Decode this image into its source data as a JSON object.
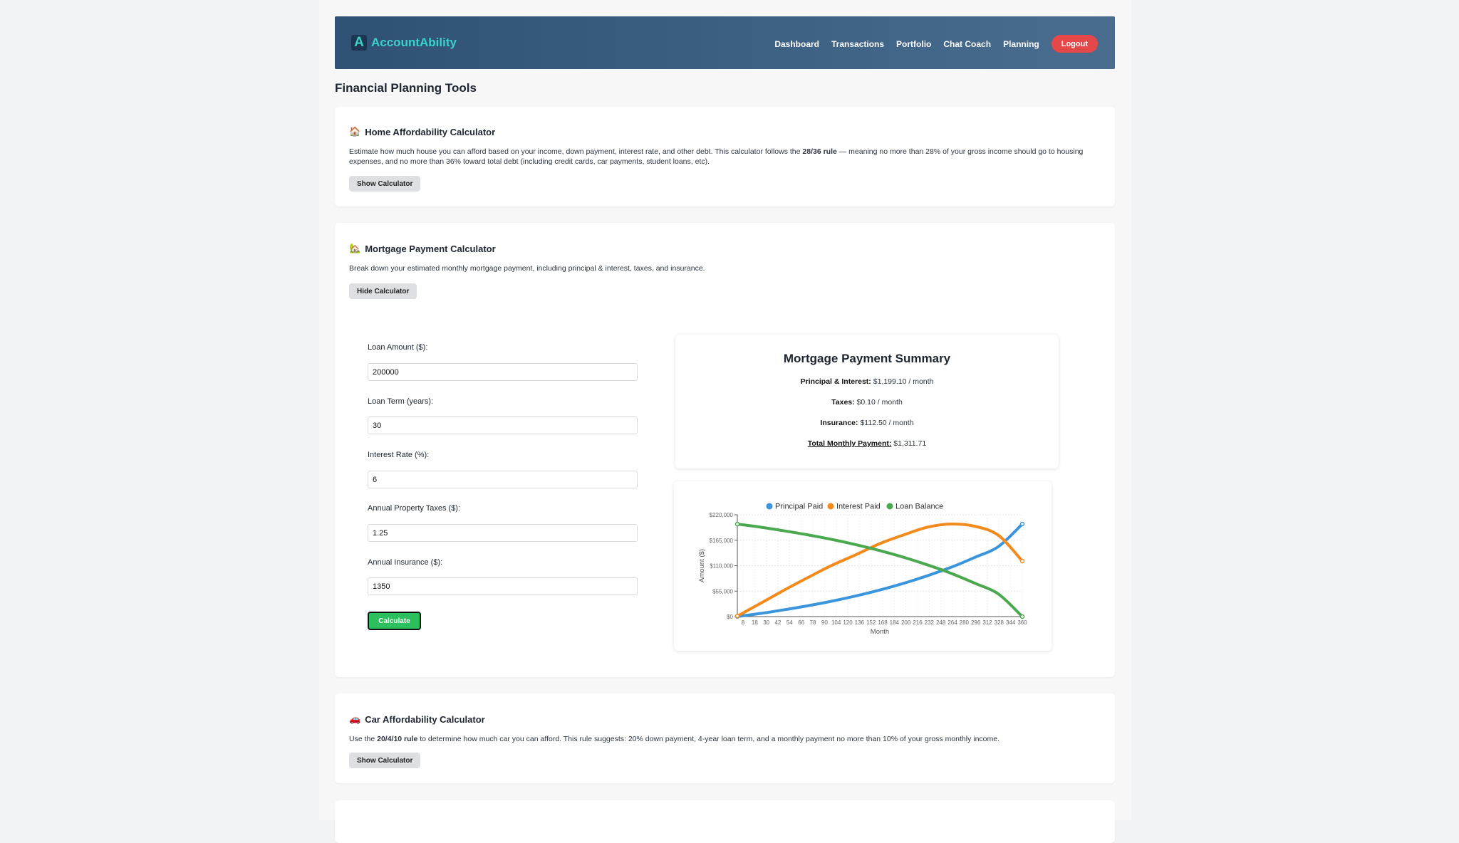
{
  "app": {
    "logo_letter": "A",
    "name": "AccountAbility"
  },
  "nav": {
    "links": [
      "Dashboard",
      "Transactions",
      "Portfolio",
      "Chat Coach",
      "Planning"
    ],
    "logout": "Logout"
  },
  "page_title": "Financial Planning Tools",
  "home": {
    "icon": "🏠",
    "title": "Home Affordability Calculator",
    "desc_pre": "Estimate how much house you can afford based on your income, down payment, interest rate, and other debt. This calculator follows the ",
    "desc_bold": "28/36 rule",
    "desc_post": " — meaning no more than 28% of your gross income should go to housing expenses, and no more than 36% toward total debt (including credit cards, car payments, student loans, etc).",
    "button": "Show Calculator"
  },
  "mortgage": {
    "icon": "🏡",
    "title": "Mortgage Payment Calculator",
    "desc": "Break down your estimated monthly mortgage payment, including principal & interest, taxes, and insurance.",
    "button": "Hide Calculator",
    "fields": {
      "loan_amount": {
        "label": "Loan Amount ($):",
        "value": "200000"
      },
      "loan_term": {
        "label": "Loan Term (years):",
        "value": "30"
      },
      "interest_rate": {
        "label": "Interest Rate (%):",
        "value": "6"
      },
      "property_taxes": {
        "label": "Annual Property Taxes ($):",
        "value": "1.25"
      },
      "insurance": {
        "label": "Annual Insurance ($):",
        "value": "1350"
      }
    },
    "calculate": "Calculate",
    "summary": {
      "title": "Mortgage Payment Summary",
      "pi_label": "Principal & Interest:",
      "pi_value": " $1,199.10 / month",
      "taxes_label": "Taxes:",
      "taxes_value": " $0.10 / month",
      "ins_label": "Insurance:",
      "ins_value": " $112.50 / month",
      "total_label": "Total Monthly Payment:",
      "total_value": " $1,311.71"
    }
  },
  "car": {
    "icon": "🚗",
    "title": "Car Affordability Calculator",
    "desc_pre": "Use the ",
    "desc_bold": "20/4/10 rule",
    "desc_post": " to determine how much car you can afford. This rule suggests: 20% down payment, 4-year loan term, and a monthly payment no more than 10% of your gross monthly income.",
    "button": "Show Calculator"
  },
  "chart_data": {
    "type": "line",
    "xlabel": "Month",
    "ylabel": "Amount ($)",
    "xlim": [
      1,
      360
    ],
    "ylim": [
      0,
      220000
    ],
    "y_ticks": [
      0,
      55000,
      110000,
      165000,
      220000
    ],
    "y_tick_labels": [
      "$0",
      "$55,000",
      "$110,000",
      "$165,000",
      "$220,000"
    ],
    "x_tick_labels": [
      "8",
      "18",
      "30",
      "42",
      "54",
      "66",
      "78",
      "90",
      "104",
      "120",
      "136",
      "152",
      "168",
      "184",
      "200",
      "216",
      "232",
      "248",
      "264",
      "280",
      "296",
      "312",
      "328",
      "344",
      "360"
    ],
    "legend_position": "top",
    "grid": true,
    "x": [
      1,
      30,
      60,
      90,
      120,
      150,
      180,
      210,
      240,
      270,
      300,
      330,
      360
    ],
    "series": [
      {
        "name": "Principal Paid",
        "color": "#3b95dd",
        "values": [
          199,
          6700,
          14700,
          23500,
          33300,
          44500,
          57200,
          71600,
          88000,
          106300,
          127800,
          151400,
          200000
        ]
      },
      {
        "name": "Interest Paid",
        "color": "#f28a1c",
        "values": [
          1000,
          28400,
          57200,
          84400,
          110600,
          133400,
          157300,
          176200,
          193000,
          200000,
          195200,
          175500,
          120000
        ]
      },
      {
        "name": "Loan Balance",
        "color": "#4aa84e",
        "values": [
          199800,
          193300,
          185300,
          176500,
          166700,
          155500,
          142800,
          128400,
          112000,
          93700,
          72200,
          48600,
          0
        ]
      }
    ]
  }
}
